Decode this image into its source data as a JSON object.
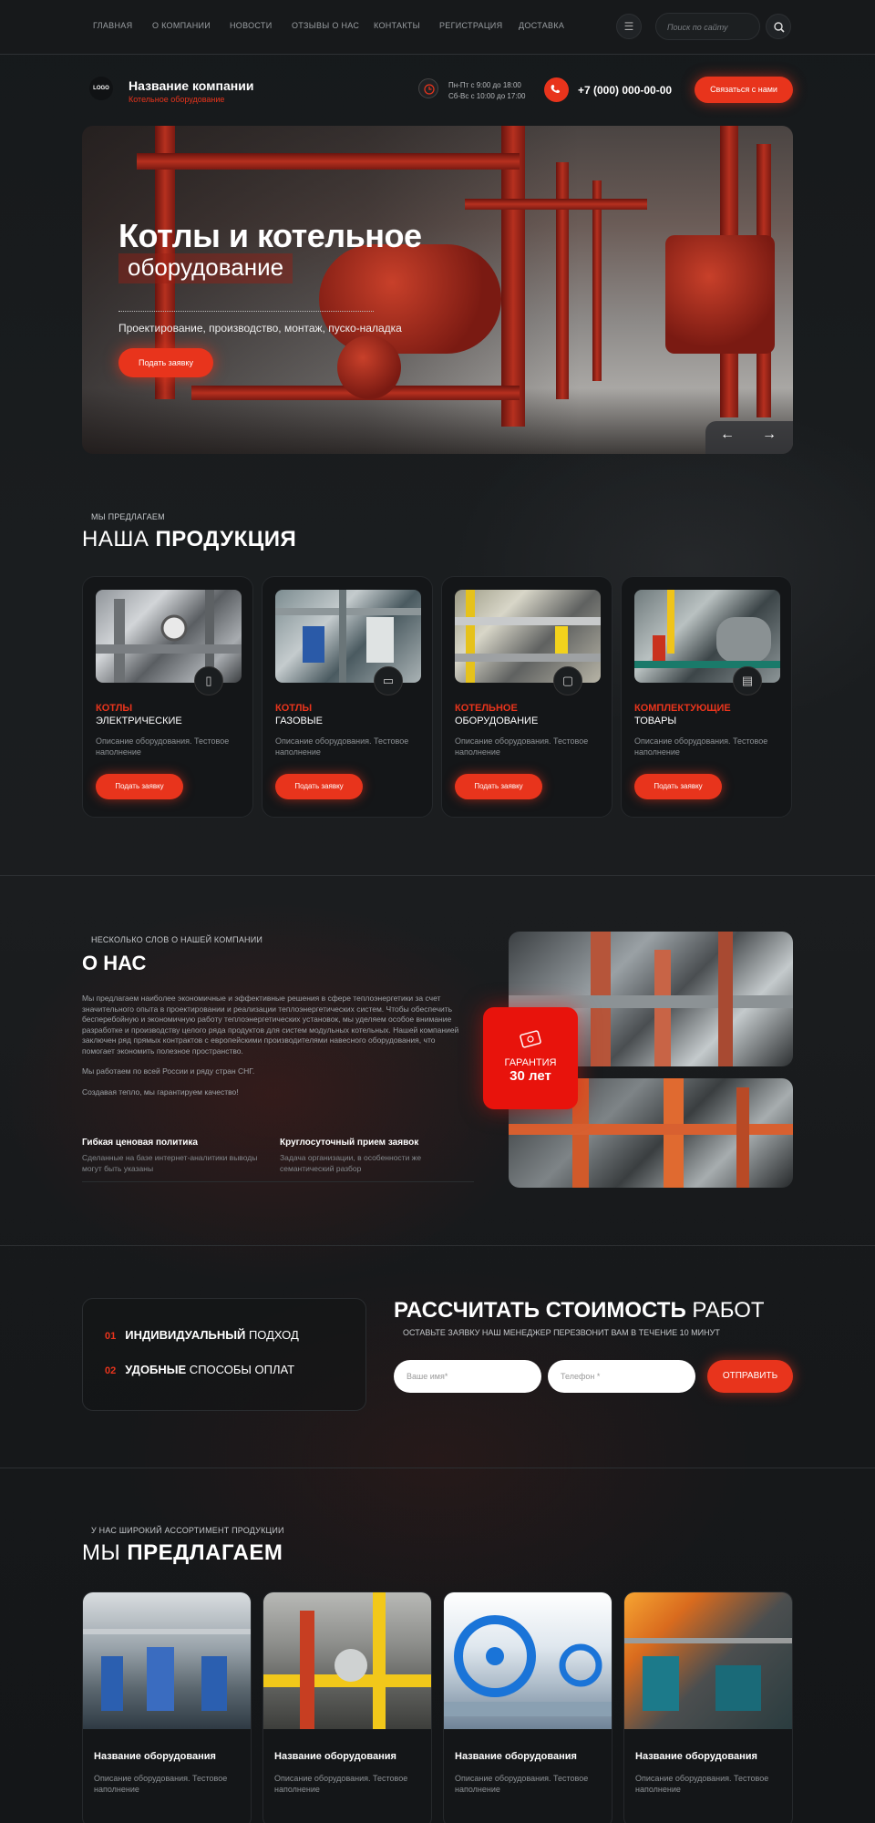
{
  "nav": {
    "items": [
      "ГЛАВНАЯ",
      "О КОМПАНИИ",
      "НОВОСТИ",
      "ОТЗЫВЫ О НАС",
      "КОНТАКТЫ",
      "РЕГИСТРАЦИЯ",
      "ДОСТАВКА"
    ],
    "search_placeholder": "Поиск по сайту",
    "menu_icon": "hamburger-icon",
    "search_icon": "search-icon"
  },
  "header": {
    "logo": "LOGO",
    "company_name": "Название компании",
    "company_sub": "Котельное оборудование",
    "hours_1": "Пн-Пт с 9:00 до 18:00",
    "hours_2": "Сб-Вс с 10:00 до 17:00",
    "phone": "+7 (000) 000-00-00",
    "cta": "Связаться с нами"
  },
  "hero": {
    "title_1": "Котлы и котельное",
    "title_2": "оборудование",
    "subtitle": "Проектирование, производство, монтаж, пуско-наладка",
    "button": "Подать заявку",
    "prev": "←",
    "next": "→"
  },
  "products": {
    "eyebrow": "МЫ ПРЕДЛАГАЕМ",
    "title_light": "НАША ",
    "title_bold": "ПРОДУКЦИЯ",
    "cards": [
      {
        "t1": "КОТЛЫ",
        "t2": "ЭЛЕКТРИЧЕСКИЕ",
        "desc": "Описание оборудования. Тестовое наполнение",
        "button": "Подать заявку",
        "icon": "phone-device-icon"
      },
      {
        "t1": "КОТЛЫ",
        "t2": "ГАЗОВЫЕ",
        "desc": "Описание оборудования. Тестовое наполнение",
        "button": "Подать заявку",
        "icon": "gas-boiler-icon"
      },
      {
        "t1": "КОТЕЛЬНОЕ",
        "t2": "ОБОРУДОВАНИЕ",
        "desc": "Описание оборудования. Тестовое наполнение",
        "button": "Подать заявку",
        "icon": "water-heater-icon"
      },
      {
        "t1": "КОМПЛЕКТУЮЩИЕ",
        "t2": "ТОВАРЫ",
        "desc": "Описание оборудования. Тестовое наполнение",
        "button": "Подать заявку",
        "icon": "radiator-icon"
      }
    ]
  },
  "about": {
    "eyebrow": "НЕСКОЛЬКО СЛОВ О НАШЕЙ КОМПАНИИ",
    "title": "О НАС",
    "p1": "Мы предлагаем наиболее экономичные и эффективные решения в сфере теплоэнергетики за счет значительного опыта в проектировании и реализации теплоэнергетических систем. Чтобы обеспечить бесперебойную и экономичную работу теплоэнергетических установок, мы уделяем особое внимание разработке и производству целого ряда продуктов для систем модульных котельных. Нашей компанией заключен ряд прямых контрактов с европейскими производителями навесного оборудования, что помогает экономить полезное пространство.",
    "p2": "Мы работаем по всей России и ряду стран СНГ.",
    "p3": "Создавая тепло, мы гарантируем качество!",
    "f1_title": "Гибкая ценовая политика",
    "f1_desc": "Сделанные на базе интернет-аналитики выводы могут быть указаны",
    "f2_title": "Круглосуточный прием заявок",
    "f2_desc": "Задача организации, в особенности же семантический разбор",
    "guarantee_1": "ГАРАНТИЯ",
    "guarantee_2": "30 лет"
  },
  "calc": {
    "r1_num": "01",
    "r1_bold": "ИНДИВИДУАЛЬНЫЙ",
    "r1_light": " ПОДХОД",
    "r2_num": "02",
    "r2_bold": "УДОБНЫЕ",
    "r2_light": " СПОСОБЫ ОПЛАТ",
    "title_bold": "РАССЧИТАТЬ СТОИМОСТЬ",
    "title_light": " РАБОТ",
    "subtitle": "ОСТАВЬТЕ ЗАЯВКУ НАШ МЕНЕДЖЕР ПЕРЕЗВОНИТ ВАМ В ТЕЧЕНИЕ 10 МИНУТ",
    "name_placeholder": "Ваше имя*",
    "phone_placeholder": "Телефон *",
    "send": "ОТПРАВИТЬ"
  },
  "offer": {
    "eyebrow": "У НАС ШИРОКИЙ АССОРТИМЕНТ ПРОДУКЦИИ",
    "title_light": "МЫ ",
    "title_bold": "ПРЕДЛАГАЕМ",
    "cards": [
      {
        "title": "Название оборудования",
        "desc": "Описание оборудования. Тестовое наполнение"
      },
      {
        "title": "Название оборудования",
        "desc": "Описание оборудования. Тестовое наполнение"
      },
      {
        "title": "Название оборудования",
        "desc": "Описание оборудования. Тестовое наполнение"
      },
      {
        "title": "Название оборудования",
        "desc": "Описание оборудования. Тестовое наполнение"
      }
    ]
  },
  "colors": {
    "accent": "#e8341c",
    "background": "#17191b",
    "card": "#141618"
  }
}
